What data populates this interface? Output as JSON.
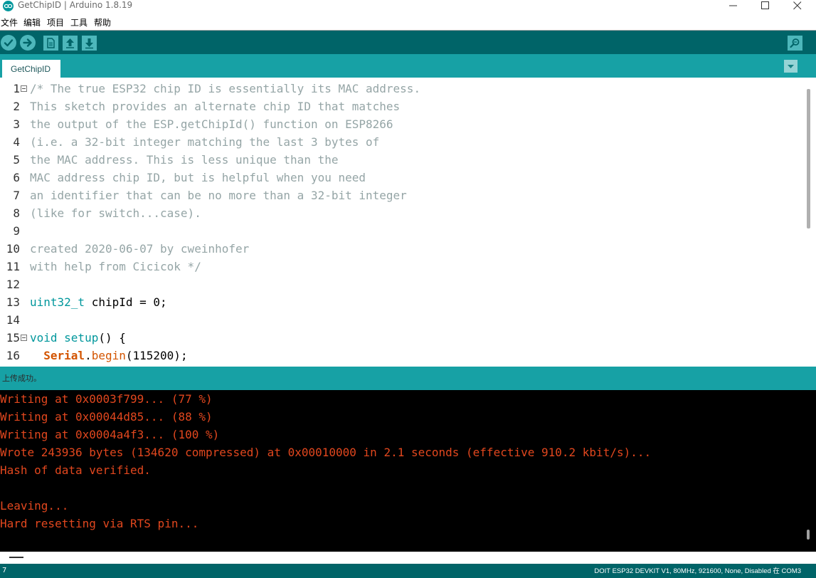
{
  "window": {
    "title": "GetChipID | Arduino 1.8.19"
  },
  "menu": {
    "items": [
      "文件",
      "编辑",
      "项目",
      "工具",
      "帮助"
    ]
  },
  "toolbar": {
    "buttons": [
      "verify-icon",
      "upload-icon",
      "new-icon",
      "open-icon",
      "save-icon"
    ],
    "right_button": "serial-monitor-icon"
  },
  "tabs": {
    "active": "GetChipID"
  },
  "editor": {
    "line_numbers": [
      "1",
      "2",
      "3",
      "4",
      "5",
      "6",
      "7",
      "8",
      "9",
      "10",
      "11",
      "12",
      "13",
      "14",
      "15",
      "16"
    ],
    "lines": [
      "/* The true ESP32 chip ID is essentially its MAC address.",
      "This sketch provides an alternate chip ID that matches",
      "the output of the ESP.getChipId() function on ESP8266",
      "(i.e. a 32-bit integer matching the last 3 bytes of",
      "the MAC address. This is less unique than the",
      "MAC address chip ID, but is helpful when you need",
      "an identifier that can be no more than a 32-bit integer",
      "(like for switch...case).",
      "",
      "created 2020-06-07 by cweinhofer",
      "with help from Cicicok */",
      "",
      "uint32_t chipId = 0;",
      "",
      "void setup() {",
      "  Serial.begin(115200);"
    ],
    "tokens": {
      "line13_type": "uint32_t",
      "line13_rest": " chipId = 0;",
      "line15_kw": "void",
      "line15_fn": " setup",
      "line15_rest": "() {",
      "line16_indent": "  ",
      "line16_class": "Serial",
      "line16_dot": ".",
      "line16_fn": "begin",
      "line16_rest": "(115200);"
    }
  },
  "status": {
    "message": "上传成功。"
  },
  "console": {
    "lines": [
      "Writing at 0x0003f799... (77 %)",
      "Writing at 0x00044d85... (88 %)",
      "Writing at 0x0004a4f3... (100 %)",
      "Wrote 243936 bytes (134620 compressed) at 0x00010000 in 2.1 seconds (effective 910.2 kbit/s)...",
      "Hash of data verified.",
      "",
      "Leaving...",
      "Hard resetting via RTS pin..."
    ]
  },
  "footer": {
    "line": "7",
    "board": "DOIT ESP32 DEVKIT V1, 80MHz, 921600, None, Disabled 在 COM3"
  },
  "colors": {
    "toolbar": "#006468",
    "tabbar": "#17a1a5",
    "button": "#4db7bb",
    "comment": "#95a5a6",
    "keyword": "#00979c",
    "function": "#d35400",
    "console_text": "#e2471e"
  }
}
